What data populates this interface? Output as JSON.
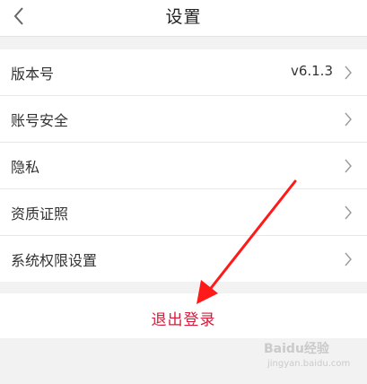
{
  "header": {
    "title": "设置",
    "back_icon": "chevron-left-icon"
  },
  "settings": {
    "items": [
      {
        "label": "版本号",
        "value": "v6.1.3"
      },
      {
        "label": "账号安全"
      },
      {
        "label": "隐私"
      },
      {
        "label": "资质证照"
      },
      {
        "label": "系统权限设置"
      }
    ]
  },
  "logout": {
    "label": "退出登录",
    "color": "#d61c3c"
  },
  "annotation": {
    "arrow_color": "#ff1a1a"
  },
  "watermark": {
    "brand": "Baidu经验",
    "url": "jingyan.baidu.com"
  }
}
